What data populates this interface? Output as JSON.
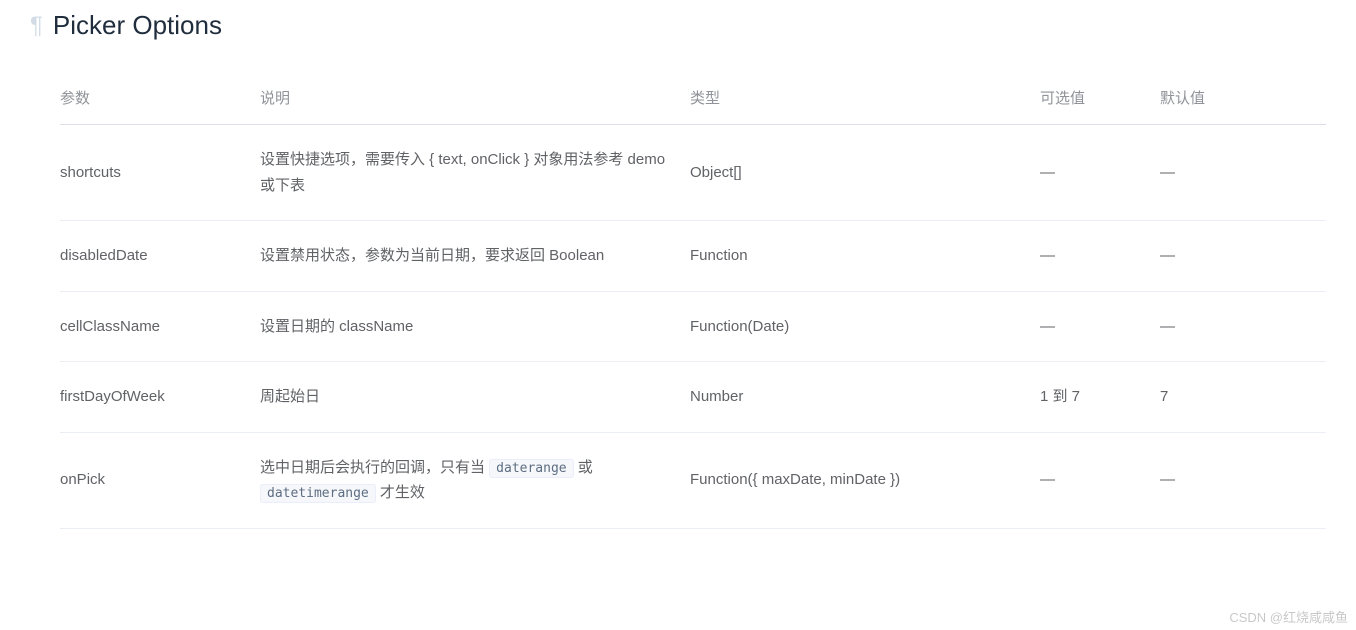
{
  "heading": {
    "title": "Picker Options"
  },
  "table": {
    "headers": {
      "param": "参数",
      "desc": "说明",
      "type": "类型",
      "options": "可选值",
      "default": "默认值"
    },
    "rows": [
      {
        "param": "shortcuts",
        "desc": "设置快捷选项，需要传入 { text, onClick } 对象用法参考 demo 或下表",
        "type": "Object[]",
        "options": "—",
        "default": "—"
      },
      {
        "param": "disabledDate",
        "desc": "设置禁用状态，参数为当前日期，要求返回 Boolean",
        "type": "Function",
        "options": "—",
        "default": "—"
      },
      {
        "param": "cellClassName",
        "desc": "设置日期的 className",
        "type": "Function(Date)",
        "options": "—",
        "default": "—"
      },
      {
        "param": "firstDayOfWeek",
        "desc": "周起始日",
        "type": "Number",
        "options": "1 到 7",
        "default": "7"
      },
      {
        "param": "onPick",
        "desc_prefix": "选中日期后会执行的回调，只有当 ",
        "desc_code1": "daterange",
        "desc_mid": " 或 ",
        "desc_code2": "datetimerange",
        "desc_suffix": " 才生效",
        "type": "Function({ maxDate, minDate })",
        "options": "—",
        "default": "—"
      }
    ]
  },
  "watermark": "CSDN @红烧咸咸鱼"
}
